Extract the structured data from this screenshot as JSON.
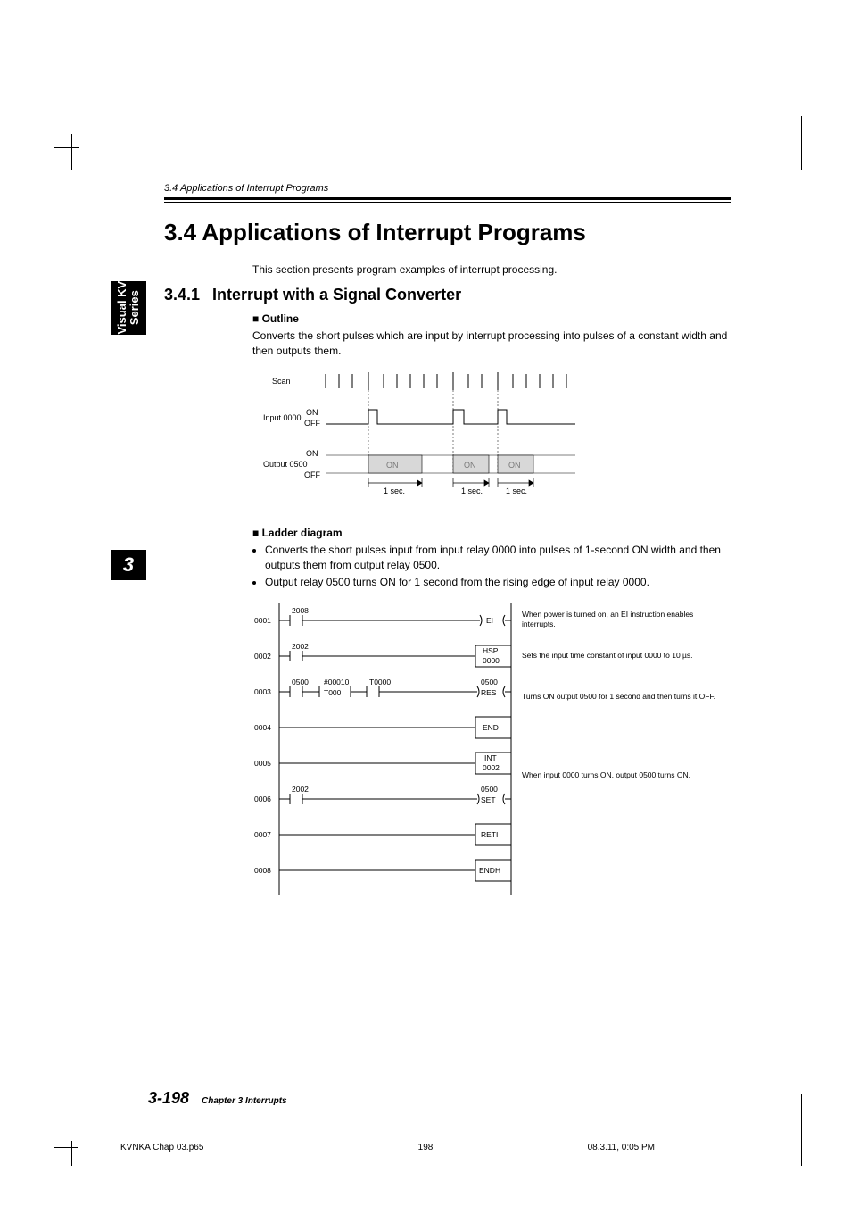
{
  "running_head": "3.4  Applications of Interrupt Programs",
  "h1": "3.4   Applications of Interrupt Programs",
  "intro": "This section presents program examples of interrupt processing.",
  "side_tab_line1": "Visual KV",
  "side_tab_line2": "Series",
  "chapter_tab": "3",
  "h2_num": "3.4.1",
  "h2_title": "Interrupt with a Signal Converter",
  "outline_head": "■ Outline",
  "outline_body": "Converts the short pulses which are input by interrupt processing into pulses of a constant width and then outputs them.",
  "timing": {
    "scan": "Scan",
    "input": "Input 0000",
    "output": "Output 0500",
    "on": "ON",
    "off": "OFF",
    "one_sec": "1 sec."
  },
  "ladder_head": "■ Ladder diagram",
  "ladder_bullets": [
    "Converts the short pulses input from input relay 0000 into pulses of 1-second ON width and then outputs them from output relay 0500.",
    "Output relay 0500 turns ON for 1 second from the rising edge of input relay 0000."
  ],
  "ladder": {
    "rows": [
      "0001",
      "0002",
      "0003",
      "0004",
      "0005",
      "0006",
      "0007",
      "0008"
    ],
    "r1_c1": "2008",
    "r1_out": "EI",
    "r2_c1": "2002",
    "r2_out_top": "HSP",
    "r2_out_num": "0000",
    "r3_c1": "0500",
    "r3_c2a": "#00010",
    "r3_c2b": "T000",
    "r3_c3": "T0000",
    "r3_out_top": "0500",
    "r3_out": "RES",
    "r4_out": "END",
    "r5_out_top": "INT",
    "r5_out_num": "0002",
    "r6_c1": "2002",
    "r6_out_top": "0500",
    "r6_out": "SET",
    "r7_out": "RETI",
    "r8_out": "ENDH"
  },
  "side_notes": {
    "n1": "When power is turned on, an EI instruction enables interrupts.",
    "n2": "Sets the input time constant of input 0000 to 10 µs.",
    "n3": "Turns ON output 0500 for 1 second and then turns it OFF.",
    "n4": "When input 0000 turns ON, output 0500 turns ON."
  },
  "footer_page": "3-198",
  "footer_chapter": "Chapter 3   Interrupts",
  "slug_left": "KVNKA Chap 03.p65",
  "slug_center": "198",
  "slug_right": "08.3.11, 0:05 PM"
}
